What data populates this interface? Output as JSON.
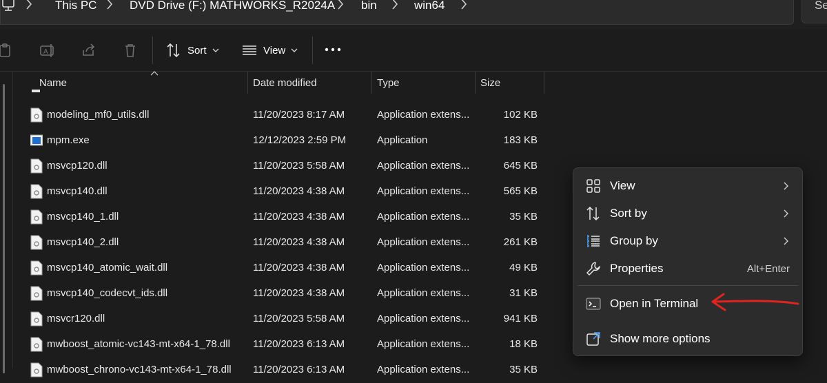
{
  "address_bar": {
    "crumbs": [
      "This PC",
      "DVD Drive (F:) MATHWORKS_R2024A",
      "bin",
      "win64"
    ],
    "search_text": "Se"
  },
  "command_bar": {
    "sort_label": "Sort",
    "view_label": "View"
  },
  "columns": {
    "name": "Name",
    "date": "Date modified",
    "type": "Type",
    "size": "Size"
  },
  "files": [
    {
      "name": "modeling_mf0_utils.dll",
      "date": "11/20/2023 8:17 AM",
      "type": "Application extens...",
      "size": "102 KB",
      "icon": "dll-file-icon"
    },
    {
      "name": "mpm.exe",
      "date": "12/12/2023 2:59 PM",
      "type": "Application",
      "size": "183 KB",
      "icon": "exe-file-icon"
    },
    {
      "name": "msvcp120.dll",
      "date": "11/20/2023 5:58 AM",
      "type": "Application extens...",
      "size": "645 KB",
      "icon": "dll-file-icon"
    },
    {
      "name": "msvcp140.dll",
      "date": "11/20/2023 4:38 AM",
      "type": "Application extens...",
      "size": "565 KB",
      "icon": "dll-file-icon"
    },
    {
      "name": "msvcp140_1.dll",
      "date": "11/20/2023 4:38 AM",
      "type": "Application extens...",
      "size": "35 KB",
      "icon": "dll-file-icon"
    },
    {
      "name": "msvcp140_2.dll",
      "date": "11/20/2023 4:38 AM",
      "type": "Application extens...",
      "size": "261 KB",
      "icon": "dll-file-icon"
    },
    {
      "name": "msvcp140_atomic_wait.dll",
      "date": "11/20/2023 4:38 AM",
      "type": "Application extens...",
      "size": "49 KB",
      "icon": "dll-file-icon"
    },
    {
      "name": "msvcp140_codecvt_ids.dll",
      "date": "11/20/2023 4:38 AM",
      "type": "Application extens...",
      "size": "31 KB",
      "icon": "dll-file-icon"
    },
    {
      "name": "msvcr120.dll",
      "date": "11/20/2023 5:58 AM",
      "type": "Application extens...",
      "size": "941 KB",
      "icon": "dll-file-icon"
    },
    {
      "name": "mwboost_atomic-vc143-mt-x64-1_78.dll",
      "date": "11/20/2023 6:13 AM",
      "type": "Application extens...",
      "size": "18 KB",
      "icon": "dll-file-icon"
    },
    {
      "name": "mwboost_chrono-vc143-mt-x64-1_78.dll",
      "date": "11/20/2023 6:13 AM",
      "type": "Application extens...",
      "size": "35 KB",
      "icon": "dll-file-icon"
    }
  ],
  "context_menu": {
    "items": [
      {
        "label": "View",
        "icon": "grid-icon",
        "submenu": true
      },
      {
        "label": "Sort by",
        "icon": "sort-icon",
        "submenu": true
      },
      {
        "label": "Group by",
        "icon": "group-list-icon",
        "submenu": true
      },
      {
        "label": "Properties",
        "icon": "wrench-icon",
        "shortcut": "Alt+Enter"
      },
      {
        "label": "Open in Terminal",
        "icon": "terminal-icon"
      },
      {
        "label": "Show more options",
        "icon": "external-options-icon"
      }
    ]
  },
  "colors": {
    "background": "#1c1c1c",
    "menu_background": "#2c2c2c",
    "annotation_arrow": "#e0241f"
  }
}
